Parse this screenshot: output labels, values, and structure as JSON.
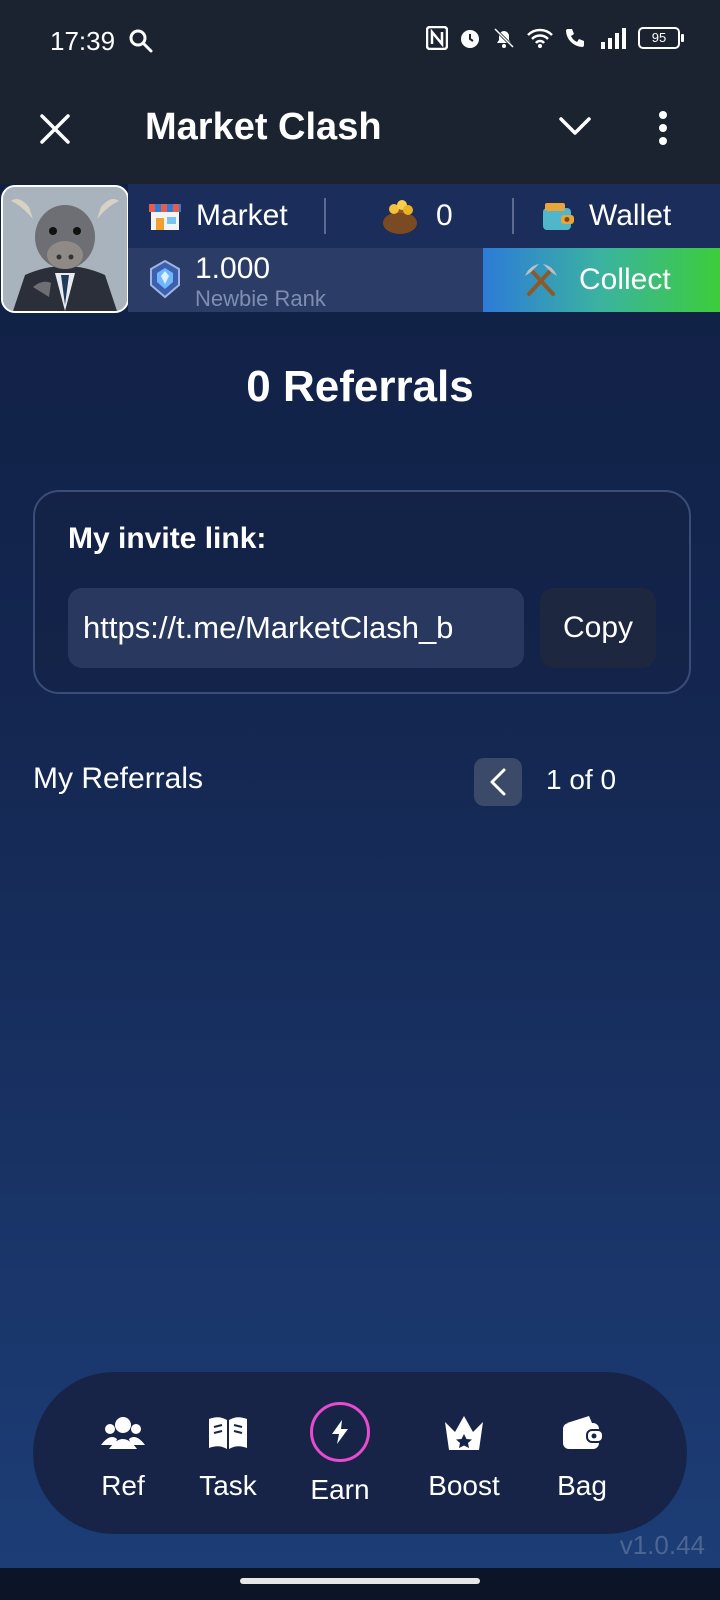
{
  "status_bar": {
    "time": "17:39",
    "battery": "95"
  },
  "header": {
    "title": "Market Clash"
  },
  "hud": {
    "market_label": "Market",
    "coins_value": "0",
    "wallet_label": "Wallet",
    "rank_value": "1.000",
    "rank_name": "Newbie Rank",
    "collect_label": "Collect"
  },
  "referrals": {
    "title": "0 Referrals",
    "invite_label": "My invite link:",
    "invite_link": "https://t.me/MarketClash_b",
    "copy_label": "Copy",
    "list_title": "My Referrals",
    "pager_text": "1 of 0"
  },
  "nav": {
    "items": [
      {
        "label": "Ref",
        "icon": "users-icon"
      },
      {
        "label": "Task",
        "icon": "book-icon"
      },
      {
        "label": "Earn",
        "icon": "bolt-icon"
      },
      {
        "label": "Boost",
        "icon": "crown-icon"
      },
      {
        "label": "Bag",
        "icon": "wallet-icon"
      }
    ]
  },
  "version": "v1.0.44",
  "colors": {
    "accent": "#e64bd0",
    "collect_start": "#2d7bd8",
    "collect_end": "#3ccd3a",
    "background_top": "#0f1d3f",
    "background_bottom": "#1d3e78"
  }
}
